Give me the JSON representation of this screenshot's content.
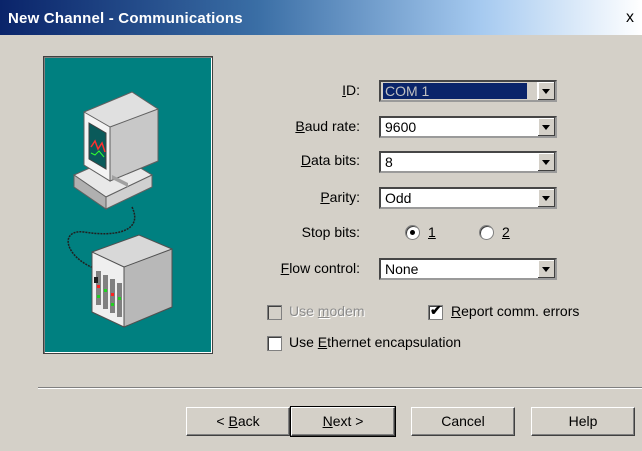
{
  "window": {
    "title": "New Channel - Communications",
    "close_glyph": "x"
  },
  "form": {
    "id": {
      "label_pre": "",
      "label_ul": "I",
      "label_post": "D:",
      "value": "COM 1"
    },
    "baud": {
      "label_pre": "",
      "label_ul": "B",
      "label_post": "aud rate:",
      "value": "9600"
    },
    "databits": {
      "label_pre": "",
      "label_ul": "D",
      "label_post": "ata bits:",
      "value": "8"
    },
    "parity": {
      "label_pre": "",
      "label_ul": "P",
      "label_post": "arity:",
      "value": "Odd"
    },
    "stopbits": {
      "label": "Stop bits:",
      "opt1": "1",
      "opt2": "2",
      "selected": "1"
    },
    "flow": {
      "label_pre": "",
      "label_ul": "F",
      "label_post": "low control:",
      "value": "None"
    },
    "use_modem": {
      "pre": "Use ",
      "ul": "m",
      "post": "odem",
      "checked": false,
      "enabled": false
    },
    "report_errors": {
      "pre": "",
      "ul": "R",
      "post": "eport comm. errors",
      "checked": true
    },
    "ethernet": {
      "pre": "Use ",
      "ul": "E",
      "post": "thernet encapsulation",
      "checked": false
    }
  },
  "buttons": {
    "back": {
      "pre": "< ",
      "ul": "B",
      "post": "ack"
    },
    "next": {
      "pre": "",
      "ul": "N",
      "post": "ext >"
    },
    "cancel": "Cancel",
    "help": "Help"
  },
  "illustration": {
    "icon": "computer-to-plc-icon"
  }
}
